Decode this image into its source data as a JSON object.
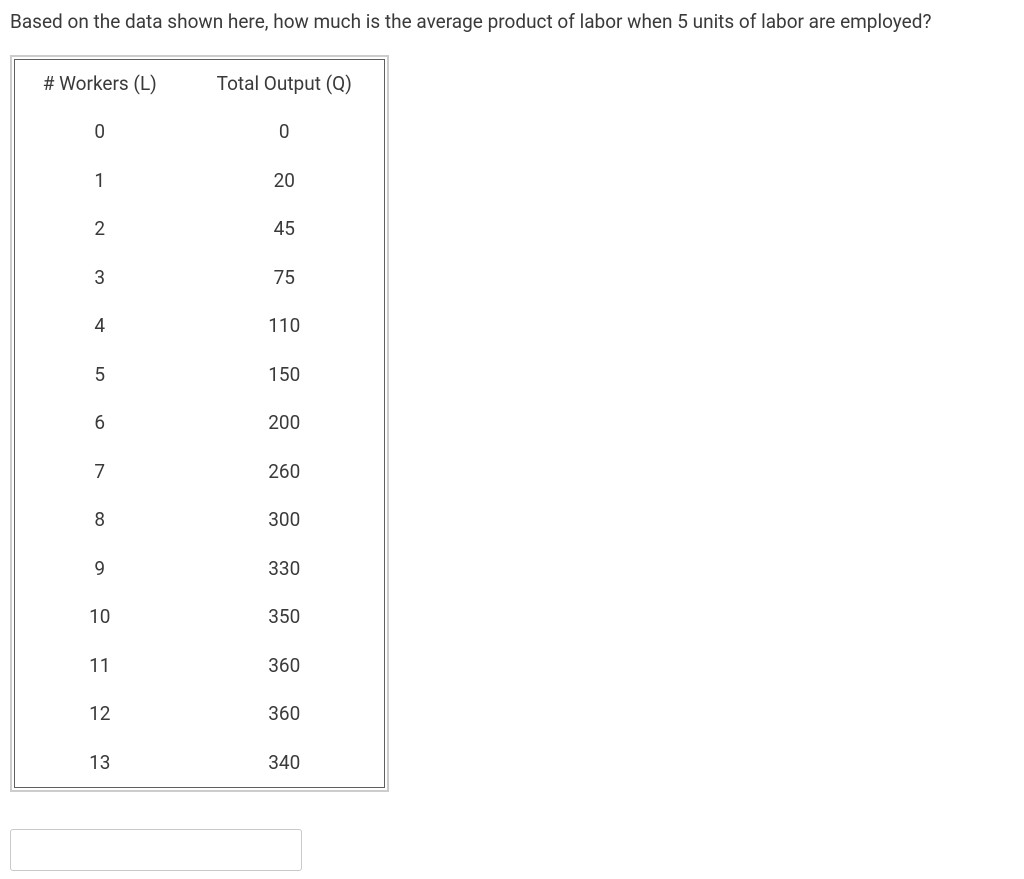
{
  "question": "Based on the data shown here, how much is the average product of labor when 5 units of labor are employed?",
  "table": {
    "headers": [
      "# Workers (L)",
      "Total Output (Q)"
    ],
    "rows": [
      [
        "0",
        "0"
      ],
      [
        "1",
        "20"
      ],
      [
        "2",
        "45"
      ],
      [
        "3",
        "75"
      ],
      [
        "4",
        "110"
      ],
      [
        "5",
        "150"
      ],
      [
        "6",
        "200"
      ],
      [
        "7",
        "260"
      ],
      [
        "8",
        "300"
      ],
      [
        "9",
        "330"
      ],
      [
        "10",
        "350"
      ],
      [
        "11",
        "360"
      ],
      [
        "12",
        "360"
      ],
      [
        "13",
        "340"
      ]
    ]
  },
  "answer": {
    "value": "",
    "placeholder": ""
  }
}
